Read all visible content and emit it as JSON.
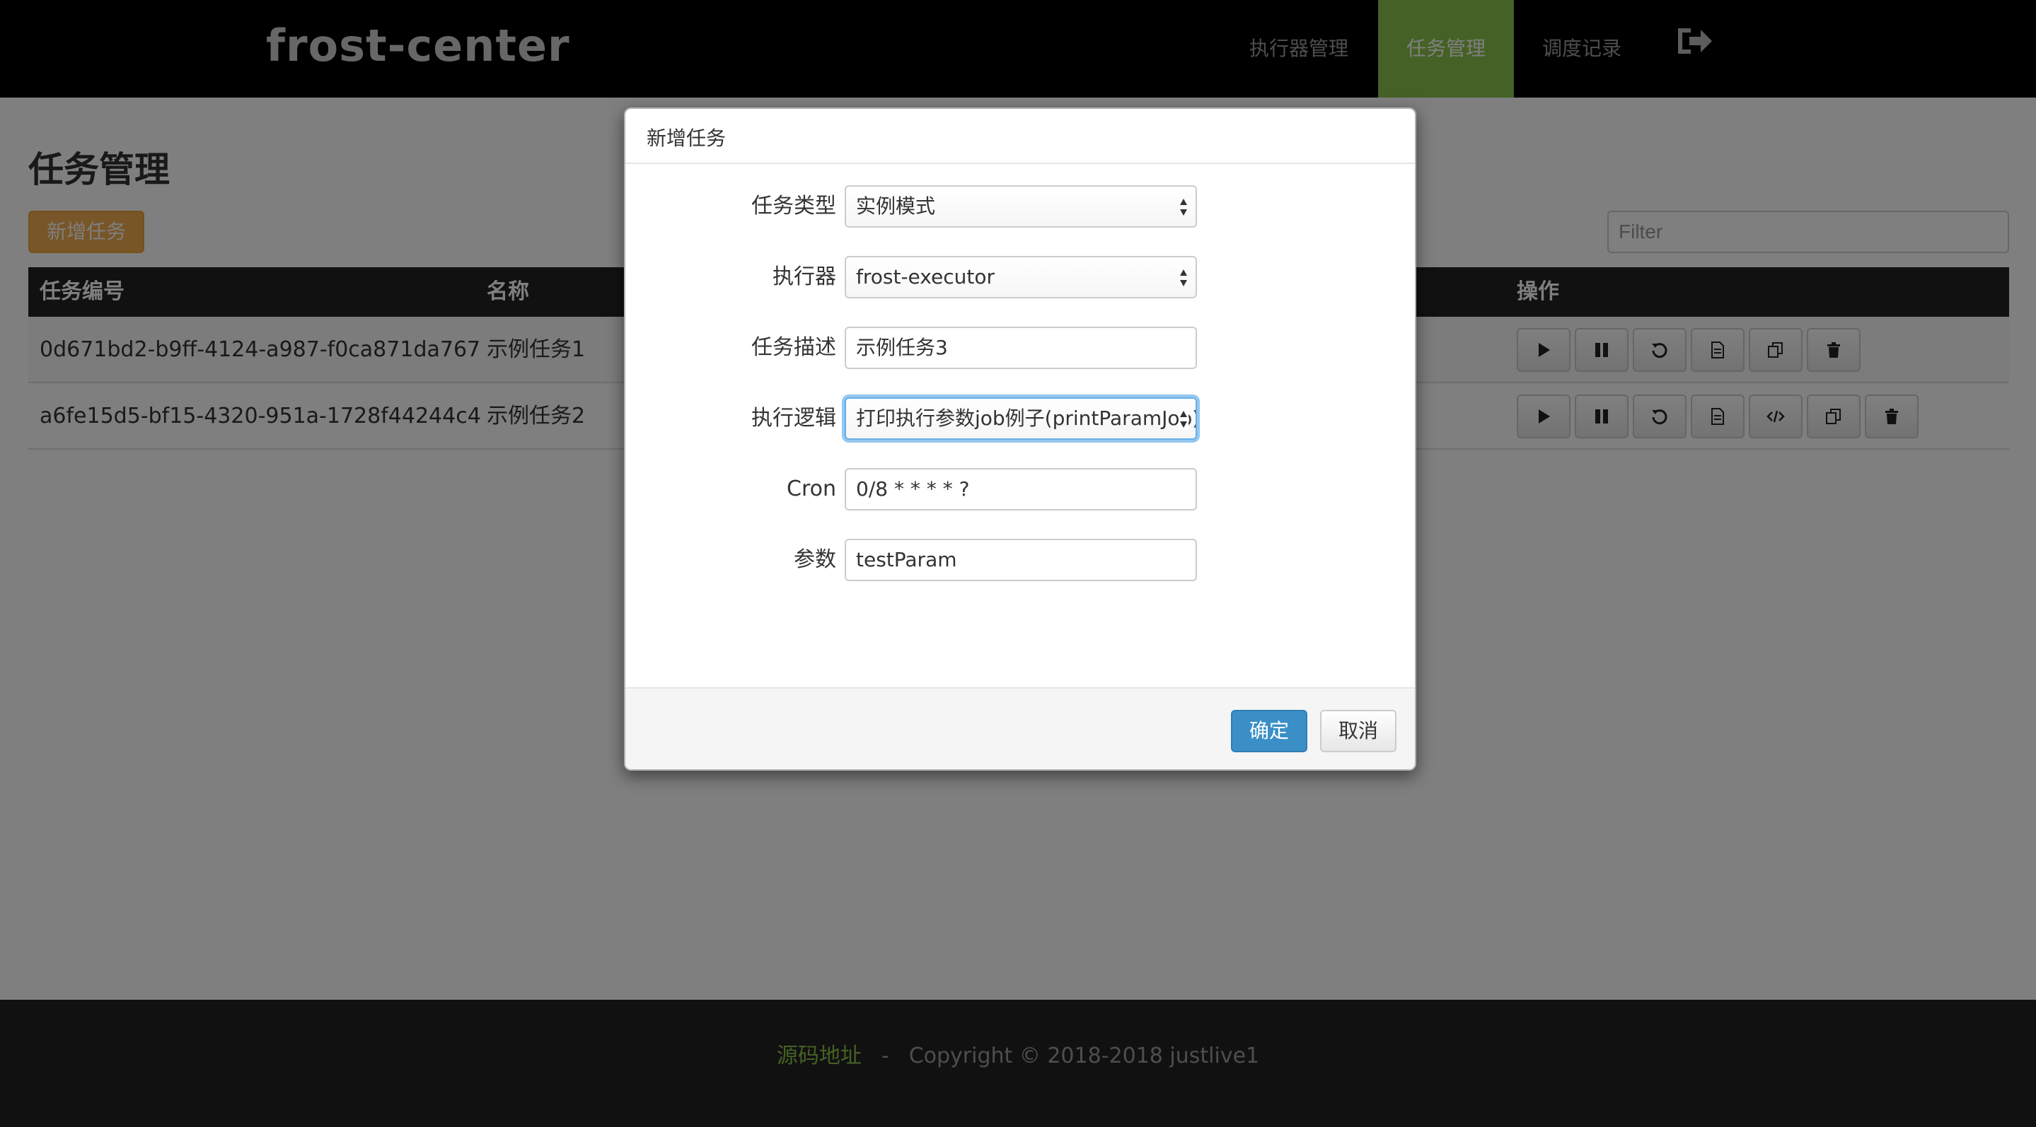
{
  "navbar": {
    "brand": "frost-center",
    "items": [
      {
        "label": "执行器管理",
        "active": false
      },
      {
        "label": "任务管理",
        "active": true
      },
      {
        "label": "调度记录",
        "active": false
      }
    ],
    "logout_icon": "sign-out-icon",
    "active_color": "#8bc34a"
  },
  "page": {
    "title": "任务管理",
    "add_button": "新增任务",
    "filter_placeholder": "Filter"
  },
  "table": {
    "headers": {
      "id": "任务编号",
      "name": "名称",
      "ops": "操作"
    },
    "rows": [
      {
        "id": "0d671bd2-b9ff-4124-a987-f0ca871da767",
        "name": "示例任务1",
        "ops": [
          "play-icon",
          "pause-icon",
          "history-icon",
          "file-icon",
          "copy-icon",
          "trash-icon"
        ]
      },
      {
        "id": "a6fe15d5-bf15-4320-951a-1728f44244c4",
        "name": "示例任务2",
        "ops": [
          "play-icon",
          "pause-icon",
          "history-icon",
          "file-icon",
          "code-icon",
          "copy-icon",
          "trash-icon"
        ]
      }
    ]
  },
  "modal": {
    "title": "新增任务",
    "fields": {
      "task_type": {
        "label": "任务类型",
        "value": "实例模式"
      },
      "executor": {
        "label": "执行器",
        "value": "frost-executor"
      },
      "description": {
        "label": "任务描述",
        "value": "示例任务3"
      },
      "logic": {
        "label": "执行逻辑",
        "value": "打印执行参数job例子(printParamJob)"
      },
      "cron": {
        "label": "Cron",
        "value": "0/8 * * * * ?"
      },
      "params": {
        "label": "参数",
        "value": "testParam"
      }
    },
    "ok_button": "确定",
    "cancel_button": "取消"
  },
  "footer": {
    "link": "源码地址",
    "separator": "-",
    "copyright": "Copyright © 2018-2018 justlive1"
  }
}
